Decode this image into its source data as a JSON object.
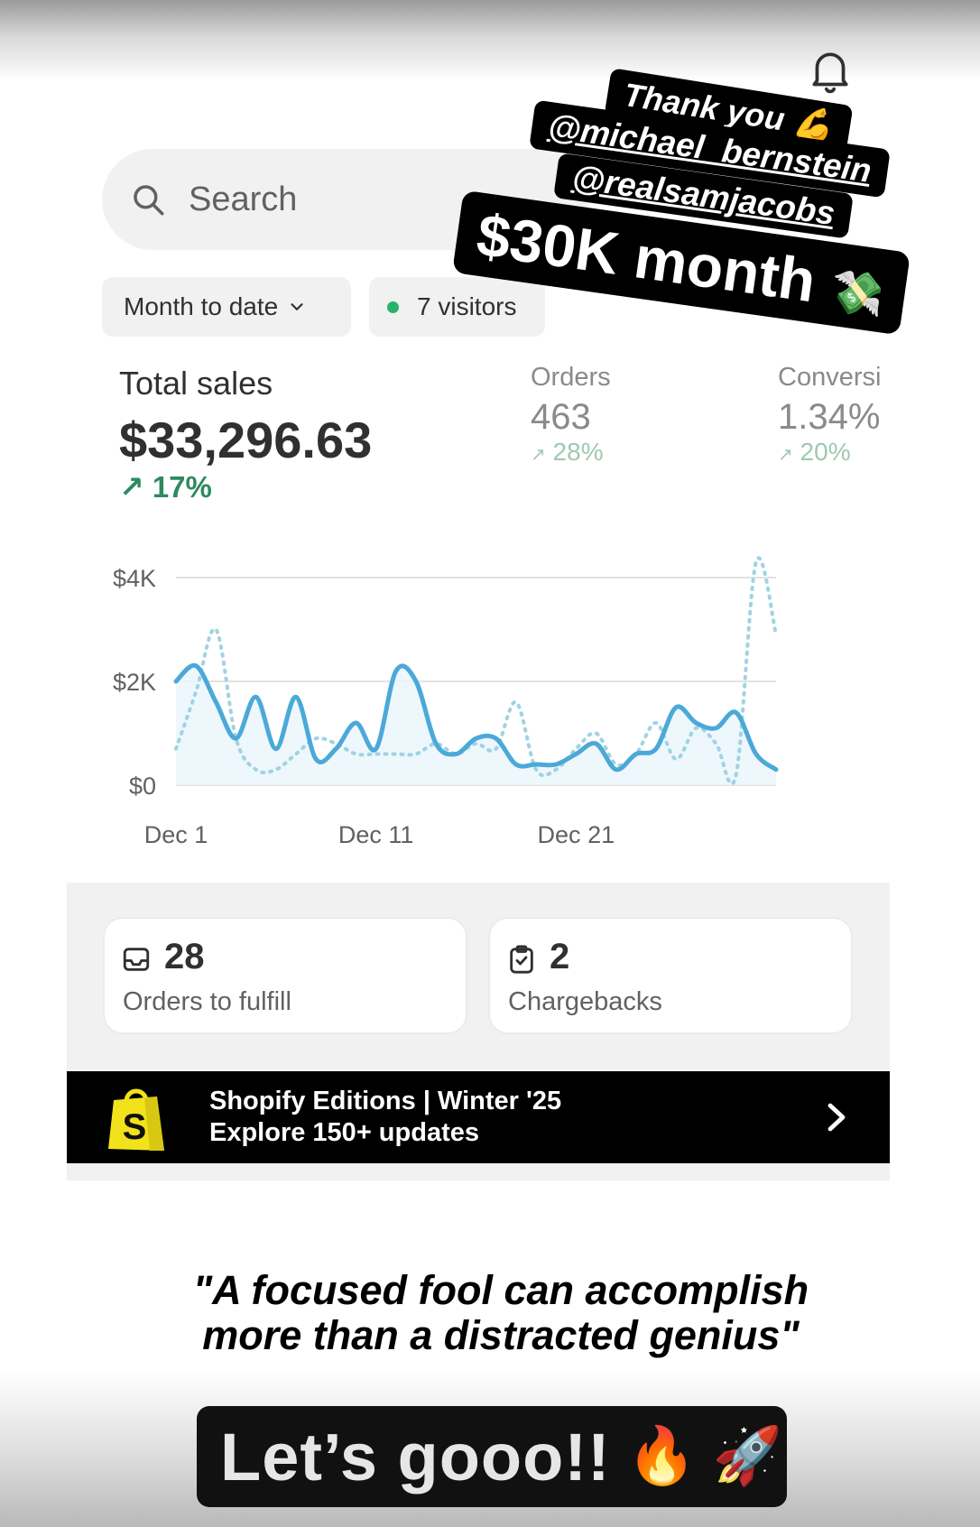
{
  "search": {
    "placeholder": "Search"
  },
  "filters": {
    "date_range": "Month to date",
    "visitors": "7 visitors"
  },
  "metrics": {
    "total_sales": {
      "label": "Total sales",
      "value": "$33,296.63",
      "change": "17%"
    },
    "orders": {
      "label": "Orders",
      "value": "463",
      "change": "28%"
    },
    "conversion": {
      "label": "Conversi",
      "value": "1.34%",
      "change": "20%"
    }
  },
  "chart_data": {
    "type": "line",
    "x": [
      "Dec 1",
      "Dec 2",
      "Dec 3",
      "Dec 4",
      "Dec 5",
      "Dec 6",
      "Dec 7",
      "Dec 8",
      "Dec 9",
      "Dec 10",
      "Dec 11",
      "Dec 12",
      "Dec 13",
      "Dec 14",
      "Dec 15",
      "Dec 16",
      "Dec 17",
      "Dec 18",
      "Dec 19",
      "Dec 20",
      "Dec 21",
      "Dec 22",
      "Dec 23",
      "Dec 24",
      "Dec 25",
      "Dec 26",
      "Dec 27",
      "Dec 28",
      "Dec 29",
      "Dec 30",
      "Dec 31"
    ],
    "xticks": [
      "Dec 1",
      "Dec 11",
      "Dec 21"
    ],
    "yticks": [
      "$0",
      "$2K",
      "$4K"
    ],
    "ylim": [
      0,
      4000
    ],
    "series": [
      {
        "values": [
          2000,
          2300,
          1600,
          900,
          1700,
          700,
          1700,
          500,
          700,
          1200,
          700,
          2200,
          2000,
          800,
          600,
          900,
          900,
          400,
          400,
          400,
          600,
          800,
          300,
          600,
          700,
          1500,
          1200,
          1100,
          1400,
          600,
          300
        ]
      },
      {
        "values": [
          700,
          1800,
          3000,
          900,
          300,
          300,
          600,
          900,
          800,
          600,
          600,
          600,
          600,
          800,
          600,
          800,
          700,
          1600,
          300,
          300,
          700,
          1000,
          400,
          600,
          1200,
          500,
          1100,
          800,
          200,
          4300,
          2900
        ]
      }
    ],
    "colors": {
      "primary": "#4ba9d8",
      "comparison": "#9fd3e3",
      "grid": "#e3e3e3"
    }
  },
  "cards": [
    {
      "icon": "inbox-icon",
      "count": "28",
      "label": "Orders to fulfill"
    },
    {
      "icon": "clipboard-check-icon",
      "count": "2",
      "label": "Chargebacks"
    }
  ],
  "banner": {
    "line1": "Shopify Editions | Winter '25",
    "line2": "Explore 150+ updates"
  },
  "stickers": {
    "thanks": "Thank you",
    "mention1": "@michael_bernstein",
    "mention2": "@realsamjacobs",
    "headline": "$30K month",
    "quote_line1": "\"A focused fool can accomplish",
    "quote_line2": "more than a distracted genius\"",
    "lets_go": "Let’s gooo!!",
    "emoji_muscle": "💪",
    "emoji_money": "💸",
    "emoji_fire": "🔥",
    "emoji_rocket": "🚀"
  }
}
